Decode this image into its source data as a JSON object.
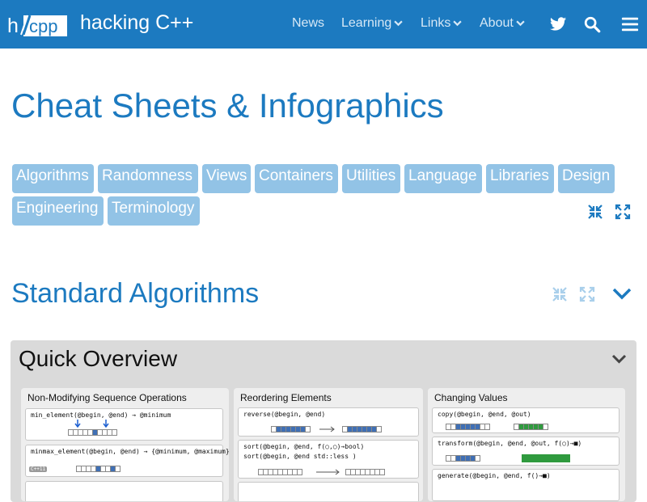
{
  "header": {
    "logo_text": "h/cpp",
    "site_title": "hacking C++",
    "nav": [
      {
        "label": "News",
        "has_menu": false
      },
      {
        "label": "Learning",
        "has_menu": true
      },
      {
        "label": "Links",
        "has_menu": true
      },
      {
        "label": "About",
        "has_menu": true
      }
    ],
    "icons": [
      "twitter-icon",
      "search-icon",
      "hamburger-menu-icon"
    ]
  },
  "page": {
    "title": "Cheat Sheets & Infographics"
  },
  "tags": [
    "Algorithms",
    "Randomness",
    "Views",
    "Containers",
    "Utilities",
    "Language",
    "Libraries",
    "Design",
    "Engineering",
    "Terminology"
  ],
  "section": {
    "title": "Standard Algorithms"
  },
  "panel": {
    "title": "Quick Overview",
    "cards": [
      {
        "title": "Non-Modifying Sequence Operations",
        "lines": [
          "min_element(@begin, @end) → @minimum",
          "minmax_element(@begin, @end) → {@minimum, @maximum}"
        ],
        "badge": "C++11"
      },
      {
        "title": "Reordering Elements",
        "lines": [
          "reverse(@begin, @end)",
          "sort(@begin, @end, f(○,○)→bool)",
          "sort(@begin, @end   std::less )"
        ]
      },
      {
        "title": "Changing Values",
        "lines": [
          "copy(@begin, @end, @out)",
          "transform(@begin, @end, @out, f(○)→■)",
          "generate(@begin, @end, f()→■)"
        ]
      }
    ]
  },
  "colors": {
    "header_bg": "#1c7ac0",
    "accent": "#1c7ac0",
    "chip_bg": "#92c3e6",
    "panel_bg": "#dadada"
  }
}
